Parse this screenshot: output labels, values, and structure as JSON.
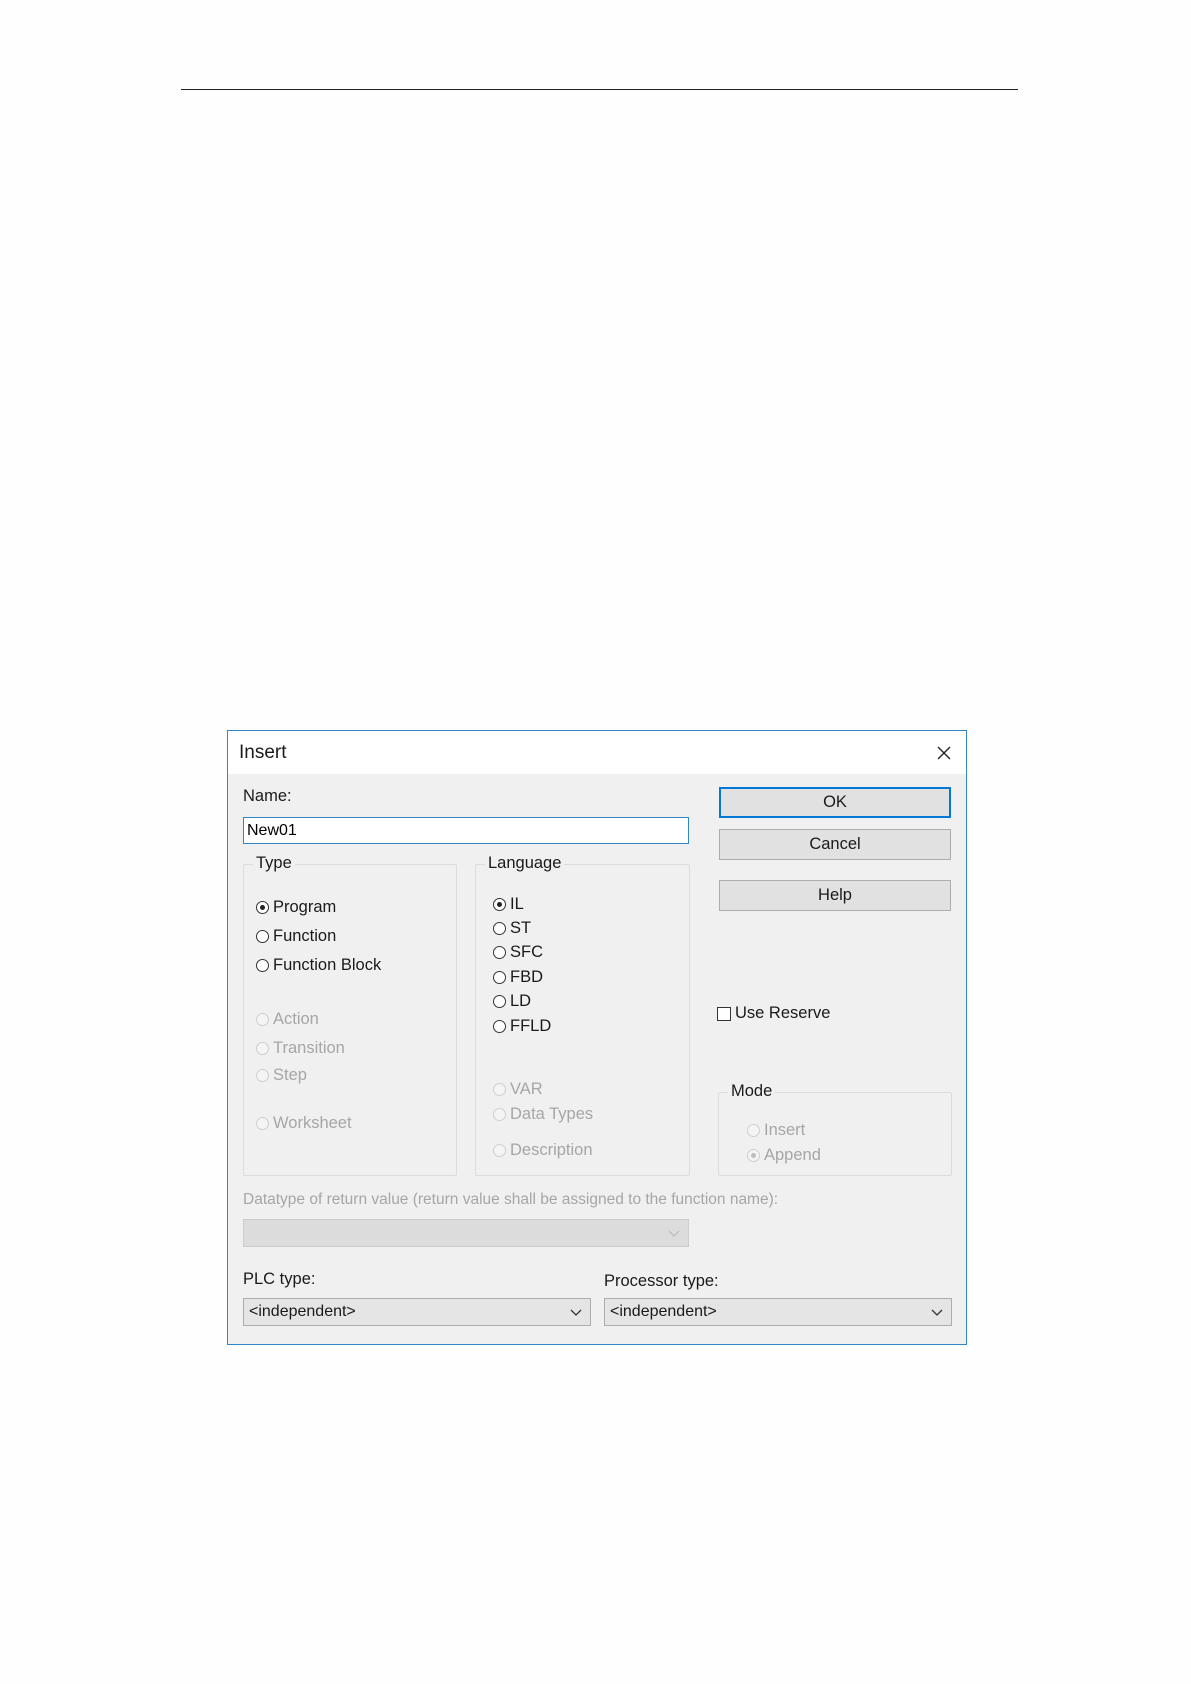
{
  "dialog": {
    "title": "Insert",
    "name_label": "Name:",
    "name_value": "New01",
    "buttons": {
      "ok": "OK",
      "cancel": "Cancel",
      "help": "Help"
    },
    "type_group": {
      "title": "Type",
      "options": [
        "Program",
        "Function",
        "Function Block",
        "Action",
        "Transition",
        "Step",
        "Worksheet"
      ],
      "selected": "Program"
    },
    "language_group": {
      "title": "Language",
      "options": [
        "IL",
        "ST",
        "SFC",
        "FBD",
        "LD",
        "FFLD",
        "VAR",
        "Data Types",
        "Description"
      ],
      "selected": "IL"
    },
    "use_reserve": {
      "label": "Use Reserve",
      "checked": false
    },
    "mode_group": {
      "title": "Mode",
      "options": [
        "Insert",
        "Append"
      ],
      "selected": "Append"
    },
    "return_datatype_label": "Datatype of return value (return value shall be assigned to the function name):",
    "return_datatype_value": "",
    "plc_type": {
      "label": "PLC type:",
      "value": "<independent>"
    },
    "processor_type": {
      "label": "Processor type:",
      "value": "<independent>"
    },
    "icons": {
      "close": "close-icon",
      "dropdown": "chevron-down-icon"
    }
  }
}
